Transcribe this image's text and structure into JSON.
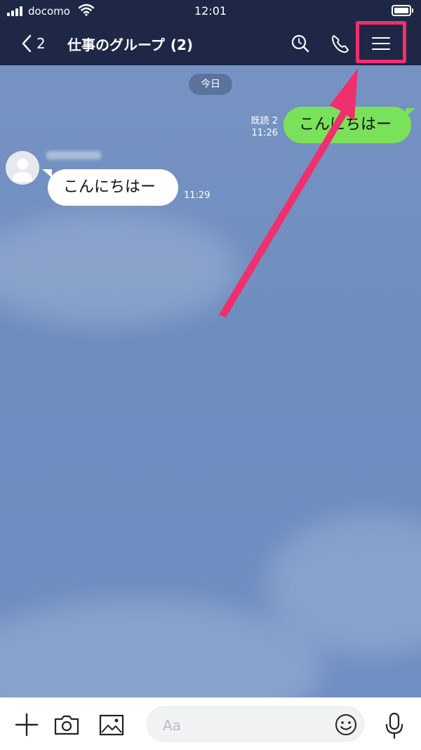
{
  "status_bar": {
    "carrier": "docomo",
    "time": "12:01"
  },
  "header": {
    "back_count": "2",
    "title": "仕事のグループ",
    "member_count": "(2)"
  },
  "chat": {
    "date_label": "今日",
    "messages": [
      {
        "direction": "sent",
        "text": "こんにちはー",
        "read_label": "既読 2",
        "time": "11:26"
      },
      {
        "direction": "received",
        "text": "こんにちはー",
        "time": "11:29"
      }
    ]
  },
  "input": {
    "placeholder": "Aa"
  },
  "colors": {
    "header_bg": "#1f2747",
    "chat_bg": "#7390c1",
    "sent_bubble": "#79e25a",
    "received_bubble": "#ffffff",
    "annotation": "#f0306c"
  },
  "icons": {
    "back": "chevron-left-icon",
    "search": "search-icon",
    "call": "phone-icon",
    "menu": "hamburger-menu-icon",
    "plus": "plus-icon",
    "camera": "camera-icon",
    "image": "image-icon",
    "emoji": "emoji-icon",
    "mic": "microphone-icon"
  }
}
